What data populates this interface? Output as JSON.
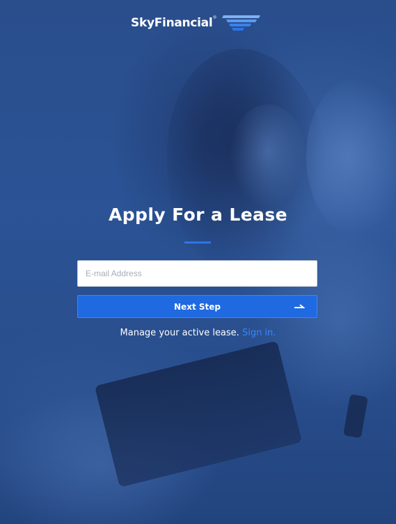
{
  "brand": {
    "name": "SkyFinancial",
    "registered_mark": "®",
    "logo_icon": "wing-stripes-icon",
    "accent_color": "#1f6ae1",
    "link_color": "#3b86f5"
  },
  "hero": {
    "title": "Apply For a Lease"
  },
  "form": {
    "email_placeholder": "E-mail Address",
    "email_value": "",
    "next_button_label": "Next Step",
    "next_button_icon": "arrow-right-icon"
  },
  "footer": {
    "manage_text": "Manage your active lease.",
    "sign_in_label": "Sign in."
  }
}
